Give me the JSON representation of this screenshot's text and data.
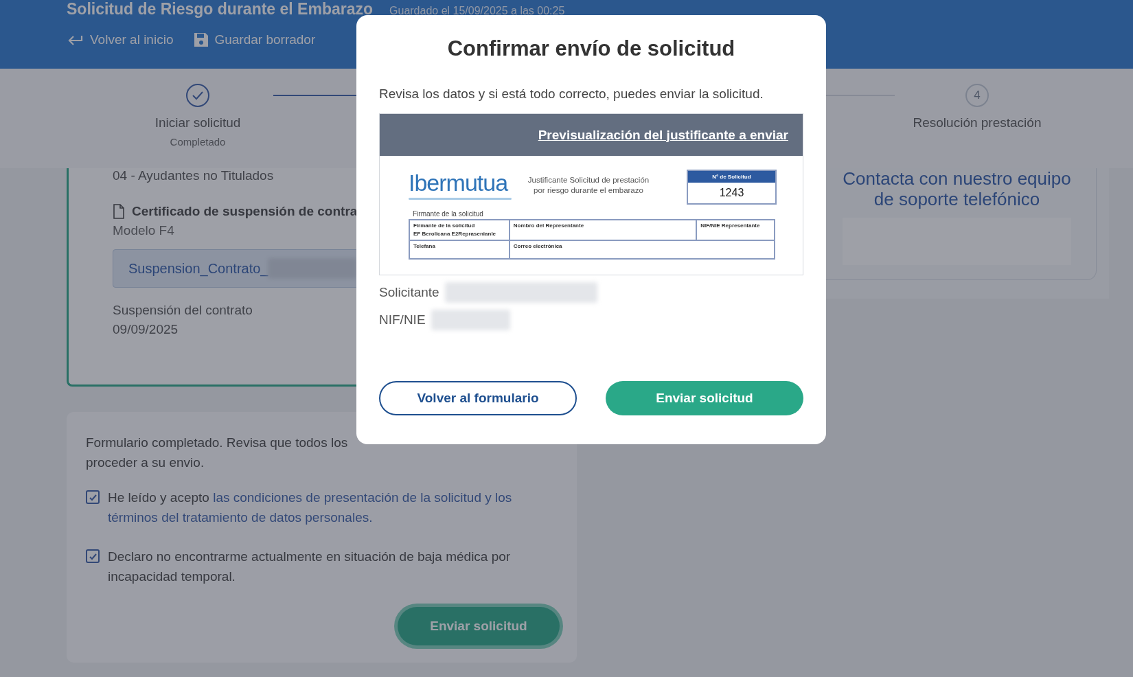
{
  "header": {
    "title": "Solicitud de Riesgo durante el Embarazo",
    "saved_note": "Guardado el 15/09/2025 a las 00:25",
    "actions": [
      {
        "label": "Volver al inicio",
        "kind": "back"
      },
      {
        "label": "Guardar borrador",
        "kind": "save"
      }
    ]
  },
  "stepper": {
    "steps": [
      {
        "label": "Iniciar solicitud",
        "status_text": "Completado",
        "completed": true
      },
      {
        "number": "4",
        "label": "Resolución prestación",
        "completed": false
      }
    ]
  },
  "document_card": {
    "category": "04 - Ayudantes no Titulados",
    "document_title": "Certificado de suspensión de contra",
    "model": "Modelo F4",
    "file_name": "Suspension_Contrato_",
    "date_label": "Suspensión del contrato",
    "date": "09/09/2025"
  },
  "submit_card": {
    "message_lines": [
      "Formulario completado. Revisa que todos los",
      "proceder a su envio."
    ],
    "checkboxes": [
      {
        "text": "He leído y acepto ",
        "link_lines": [
          "las condiciones de presentación de la solicitud y los",
          "términos del tratamiento de datos personales."
        ],
        "checked": true
      },
      {
        "text": "Declaro no encontrarme actualmente en situación de baja médica por incapacidad temporal.",
        "checked": true
      }
    ],
    "submit_button": "Enviar solicitud"
  },
  "support_panel": {
    "title": "Contacta con nuestro equipo de soporte telefónico"
  },
  "modal": {
    "title": "Confirmar envío de solicitud",
    "message": "Revisa los datos y si está todo correcto, puedes enviar la solicitud.",
    "preview": {
      "link": "Previsualización del justificante a enviar",
      "logo": "Ibermutua",
      "description": "Justificante Solicitud de prestación por riesgo durante el embarazo",
      "request_number_label": "Nº de Solicitud",
      "request_number": "1243",
      "signer_heading": "Firmante de la solicitud",
      "table_rows": [
        [
          {
            "lines": [
              "Firmante de la solicitud",
              "EF Berolicana   E2Reprasenianle"
            ]
          },
          {
            "lines": [
              "Nombro del Representante"
            ]
          },
          {
            "lines": [
              "NIF/NIE Representante"
            ]
          }
        ],
        [
          {
            "lines": [
              "Telefana"
            ]
          },
          {
            "lines": [
              "Correo electrónica"
            ]
          }
        ]
      ]
    },
    "fields": [
      {
        "label": "Solicitante"
      },
      {
        "label": "NIF/NIE"
      }
    ],
    "buttons": [
      {
        "label": "Volver al formulario",
        "kind": "secondary"
      },
      {
        "label": "Enviar solicitud",
        "kind": "primary"
      }
    ]
  }
}
